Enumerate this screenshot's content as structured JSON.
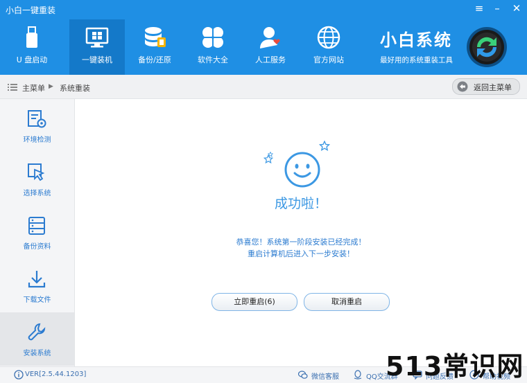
{
  "window": {
    "title": "小白一键重装",
    "controls": [
      "≡",
      "–",
      "✕"
    ]
  },
  "nav": [
    {
      "label": "U 盘启动",
      "icon": "usb-drive-icon"
    },
    {
      "label": "一键装机",
      "icon": "monitor-windows-icon",
      "active": true
    },
    {
      "label": "备份/还原",
      "icon": "database-backup-icon"
    },
    {
      "label": "软件大全",
      "icon": "clover-apps-icon"
    },
    {
      "label": "人工服务",
      "icon": "support-person-icon"
    },
    {
      "label": "官方网站",
      "icon": "globe-icon"
    }
  ],
  "brand": {
    "name": "小白系统",
    "slogan": "最好用的系统重装工具"
  },
  "breadcrumb": {
    "root": "主菜单",
    "separator": "▶",
    "current": "系统重装"
  },
  "back_button": {
    "label": "返回主菜单"
  },
  "sidebar": [
    {
      "label": "环境检测",
      "icon": "environment-check-icon"
    },
    {
      "label": "选择系统",
      "icon": "select-cursor-icon"
    },
    {
      "label": "备份资料",
      "icon": "backup-data-icon"
    },
    {
      "label": "下载文件",
      "icon": "download-icon"
    },
    {
      "label": "安装系统",
      "icon": "wrench-icon",
      "active": true
    }
  ],
  "main": {
    "success_title": "成功啦！",
    "message_line1": "恭喜您！系统第一阶段安装已经完成！",
    "message_line2": "重启计算机后进入下一步安装！",
    "restart_button": "立即重启(6)",
    "cancel_button": "取消重启"
  },
  "status": {
    "version": "VER[2.5.44.1203]",
    "wechat": "微信客服",
    "qq": "QQ交流群",
    "feedback": "问题反馈",
    "video": "帮助视频"
  },
  "watermark": "513常识网",
  "colors": {
    "header": "#1f8fe4",
    "header_active": "#1479c9",
    "accent": "#3c98e3"
  }
}
